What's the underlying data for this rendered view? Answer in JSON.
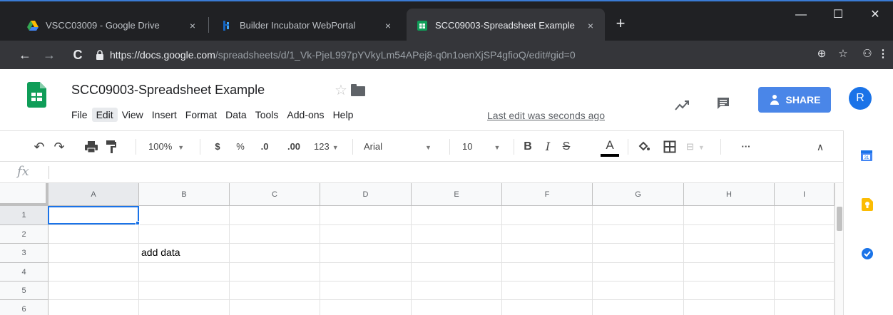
{
  "browser": {
    "tabs": [
      {
        "label": "VSCC03009 - Google Drive",
        "close": "×"
      },
      {
        "label": "Builder Incubator WebPortal",
        "close": "×"
      },
      {
        "label": "SCC09003-Spreadsheet Example",
        "close": "×"
      }
    ],
    "new_tab": "+",
    "window_controls": {
      "minimize": "—",
      "maximize": "☐",
      "close": "✕"
    },
    "url_host": "https://docs.google.com",
    "url_path": "/spreadsheets/d/1_Vk-PjeL997pYVkyLm54APej8-q0n1oenXjSP4gfioQ/edit#gid=0"
  },
  "doc": {
    "title": "SCC09003-Spreadsheet Example",
    "menu": [
      "File",
      "Edit",
      "View",
      "Insert",
      "Format",
      "Data",
      "Tools",
      "Add-ons",
      "Help"
    ],
    "last_edit": "Last edit was seconds ago",
    "share_label": "SHARE",
    "avatar_letter": "R"
  },
  "toolbar": {
    "zoom": "100%",
    "currency": "$",
    "percent": "%",
    "decimal_decrease": ".0",
    "decimal_increase": ".00",
    "format_more": "123",
    "font": "Arial",
    "font_size": "10",
    "bold": "B",
    "italic": "I",
    "strike": "S",
    "text_color": "A",
    "more": "···"
  },
  "formula_bar": {
    "fx": "fx"
  },
  "grid": {
    "columns": [
      "A",
      "B",
      "C",
      "D",
      "E",
      "F",
      "G",
      "H",
      "I"
    ],
    "rows": [
      "1",
      "2",
      "3",
      "4",
      "5",
      "6"
    ],
    "cells": {
      "B3": "add data"
    }
  },
  "colors": {
    "share_blue": "#4a86e8",
    "sheets_green": "#0f9d58",
    "selection_blue": "#1a73e8"
  }
}
